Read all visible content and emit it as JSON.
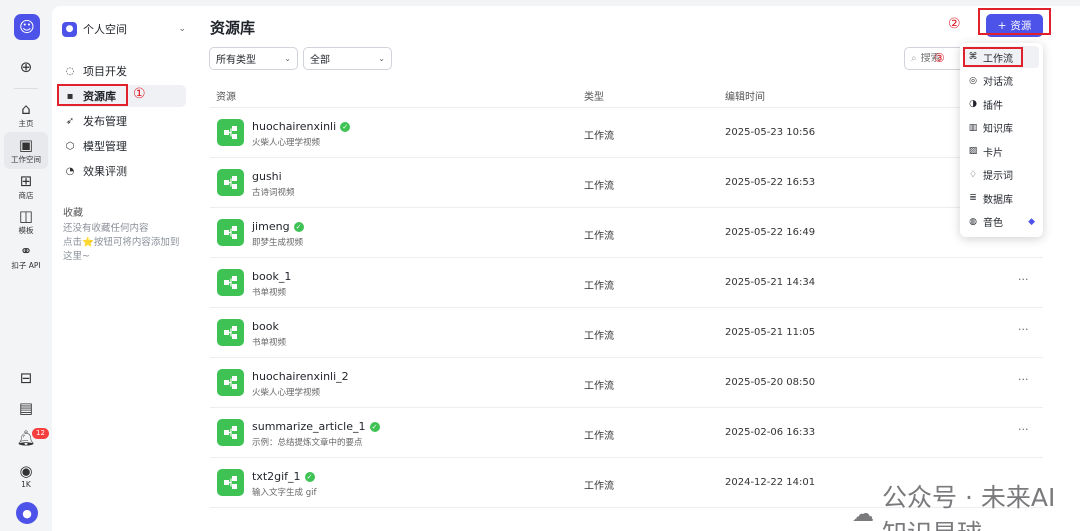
{
  "rail": {
    "items": [
      {
        "icon": "plus-circle-icon",
        "glyph": "⊕",
        "label": ""
      },
      {
        "icon": "home-icon",
        "glyph": "⌂",
        "label": "主页"
      },
      {
        "icon": "workspace-icon",
        "glyph": "▣",
        "label": "工作空间"
      },
      {
        "icon": "store-icon",
        "glyph": "⊞",
        "label": "商店"
      },
      {
        "icon": "template-icon",
        "glyph": "◫",
        "label": "模板"
      },
      {
        "icon": "api-icon",
        "glyph": "⚭",
        "label": "扣子 API"
      }
    ],
    "bottom": [
      {
        "icon": "apps-icon",
        "glyph": "⊟",
        "label": ""
      },
      {
        "icon": "doc-icon",
        "glyph": "▤",
        "label": ""
      },
      {
        "icon": "bell-icon",
        "glyph": "♫",
        "label": ""
      },
      {
        "icon": "coin-icon",
        "glyph": "◉",
        "label": "1K"
      }
    ],
    "notifications": "12"
  },
  "sidebar": {
    "space_name": "个人空间",
    "nav": [
      {
        "icon": "project-icon",
        "glyph": "◌",
        "label": "项目开发"
      },
      {
        "icon": "library-icon",
        "glyph": "▪",
        "label": "资源库"
      },
      {
        "icon": "publish-icon",
        "glyph": "➶",
        "label": "发布管理"
      },
      {
        "icon": "model-icon",
        "glyph": "⬡",
        "label": "模型管理"
      },
      {
        "icon": "evaluate-icon",
        "glyph": "◔",
        "label": "效果评测"
      }
    ],
    "favorites_title": "收藏",
    "favorites_empty": "还没有收藏任何内容\n点击⭐按钮可将内容添加到这里~"
  },
  "main": {
    "title": "资源库",
    "add_button": "资源",
    "filter_type": "所有类型",
    "filter_scope": "全部",
    "search_placeholder": "搜索",
    "columns": [
      "资源",
      "类型",
      "编辑时间"
    ],
    "rows": [
      {
        "name": "huochairenxinli",
        "desc": "火柴人心理学视频",
        "type": "工作流",
        "time": "2025-05-23 10:56",
        "published": true
      },
      {
        "name": "gushi",
        "desc": "古诗词视频",
        "type": "工作流",
        "time": "2025-05-22 16:53",
        "published": false
      },
      {
        "name": "jimeng",
        "desc": "即梦生成视频",
        "type": "工作流",
        "time": "2025-05-22 16:49",
        "published": true
      },
      {
        "name": "book_1",
        "desc": "书单视频",
        "type": "工作流",
        "time": "2025-05-21 14:34",
        "published": false
      },
      {
        "name": "book",
        "desc": "书单视频",
        "type": "工作流",
        "time": "2025-05-21 11:05",
        "published": false
      },
      {
        "name": "huochairenxinli_2",
        "desc": "火柴人心理学视频",
        "type": "工作流",
        "time": "2025-05-20 08:50",
        "published": false
      },
      {
        "name": "summarize_article_1",
        "desc": "示例：总结提炼文章中的要点",
        "type": "工作流",
        "time": "2025-02-06 16:33",
        "published": true
      },
      {
        "name": "txt2gif_1",
        "desc": "输入文字生成 gif",
        "type": "工作流",
        "time": "2024-12-22 14:01",
        "published": true
      }
    ]
  },
  "menu": {
    "items": [
      {
        "icon": "workflow-icon",
        "glyph": "⌘",
        "label": "工作流"
      },
      {
        "icon": "chatflow-icon",
        "glyph": "◎",
        "label": "对话流"
      },
      {
        "icon": "plugin-icon",
        "glyph": "◑",
        "label": "插件"
      },
      {
        "icon": "knowledge-icon",
        "glyph": "▥",
        "label": "知识库"
      },
      {
        "icon": "card-icon",
        "glyph": "▨",
        "label": "卡片"
      },
      {
        "icon": "prompt-icon",
        "glyph": "♢",
        "label": "提示词"
      },
      {
        "icon": "database-icon",
        "glyph": "≣",
        "label": "数据库"
      },
      {
        "icon": "voice-icon",
        "glyph": "◍",
        "label": "音色"
      }
    ]
  },
  "annotations": {
    "one": "①",
    "two": "②",
    "three": "③"
  },
  "watermark": "公众号 · 未来AI知识星球",
  "colors": {
    "accent": "#4d53e8",
    "workflow_green": "#3ec254",
    "annotation_red": "#e0202a"
  }
}
